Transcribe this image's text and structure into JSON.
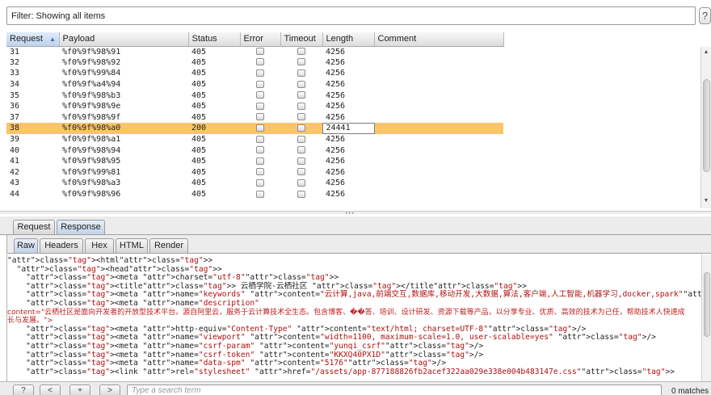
{
  "filter": {
    "text": "Filter: Showing all items"
  },
  "help_label": "?",
  "table": {
    "columns": [
      "Request",
      "Payload",
      "Status",
      "Error",
      "Timeout",
      "Length",
      "Comment"
    ],
    "rows": [
      {
        "request": "31",
        "payload": "%f0%9f%98%91",
        "status": "405",
        "length": "4256"
      },
      {
        "request": "32",
        "payload": "%f0%9f%98%92",
        "status": "405",
        "length": "4256"
      },
      {
        "request": "33",
        "payload": "%f0%9f%99%84",
        "status": "405",
        "length": "4256"
      },
      {
        "request": "34",
        "payload": "%f0%9f%a4%94",
        "status": "405",
        "length": "4256"
      },
      {
        "request": "35",
        "payload": "%f0%9f%98%b3",
        "status": "405",
        "length": "4256"
      },
      {
        "request": "36",
        "payload": "%f0%9f%98%9e",
        "status": "405",
        "length": "4256"
      },
      {
        "request": "37",
        "payload": "%f0%9f%98%9f",
        "status": "405",
        "length": "4256"
      },
      {
        "request": "38",
        "payload": "%f0%9f%98%a0",
        "status": "200",
        "length": "24441",
        "selected": true
      },
      {
        "request": "39",
        "payload": "%f0%9f%98%a1",
        "status": "405",
        "length": "4256"
      },
      {
        "request": "40",
        "payload": "%f0%9f%98%94",
        "status": "405",
        "length": "4256"
      },
      {
        "request": "41",
        "payload": "%f0%9f%98%95",
        "status": "405",
        "length": "4256"
      },
      {
        "request": "42",
        "payload": "%f0%9f%99%81",
        "status": "405",
        "length": "4256"
      },
      {
        "request": "43",
        "payload": "%f0%9f%98%a3",
        "status": "405",
        "length": "4256"
      },
      {
        "request": "44",
        "payload": "%f0%9f%98%96",
        "status": "405",
        "length": "4256"
      }
    ]
  },
  "tabs": {
    "request": "Request",
    "response": "Response"
  },
  "subtabs": {
    "raw": "Raw",
    "headers": "Headers",
    "hex": "Hex",
    "html": "HTML",
    "render": "Render"
  },
  "code_lines": [
    "<html>",
    "  <head>",
    "    <meta charset=\"utf-8\">",
    "    <title> 云栖学院-云栖社区 </title>",
    "    <meta name=\"keywords\" content=\"云计算,java,前端交互,数据库,移动开发,大数据,算法,客户端,人工智能,机器学习,docker,spark\"/>",
    "    <meta name=\"description\"",
    "content=\"云栖社区是面向开发者的开放型技术平台。源自阿里云，服务于云计算技术全生态。包含博客、��答、培训、设计研发、资源下载等产品，以分享专业、优质、高效的技术为己任，帮助技术人快速成长与发展。\">",
    "    <meta http-equiv=\"Content-Type\" content=\"text/html; charset=UTF-8\"/>",
    "    <meta name=\"viewport\" content=\"width=1100, maximum-scale=1.0, user-scalable=yes\" />",
    "    <meta name=\"csrf-param\" content=\"yunqi_csrf\"/>",
    "    <meta name=\"csrf-token\" content=\"KKXQ40PX1D\"/>",
    "    <meta name=\"data-spm\" content=\"5176\"/>",
    "    <link rel=\"stylesheet\" href=\"/assets/app-877188826fb2acef322aa029e338e004b483147e.css\">"
  ],
  "bottom": {
    "help_label": "?",
    "prev_label": "<",
    "add_label": "+",
    "next_label": ">",
    "search_placeholder": "Type a search term",
    "matches": "0 matches"
  },
  "colors": {
    "selected_row": "#f9c46a",
    "tag": "#1a1aa6",
    "attribute": "#b01010"
  }
}
